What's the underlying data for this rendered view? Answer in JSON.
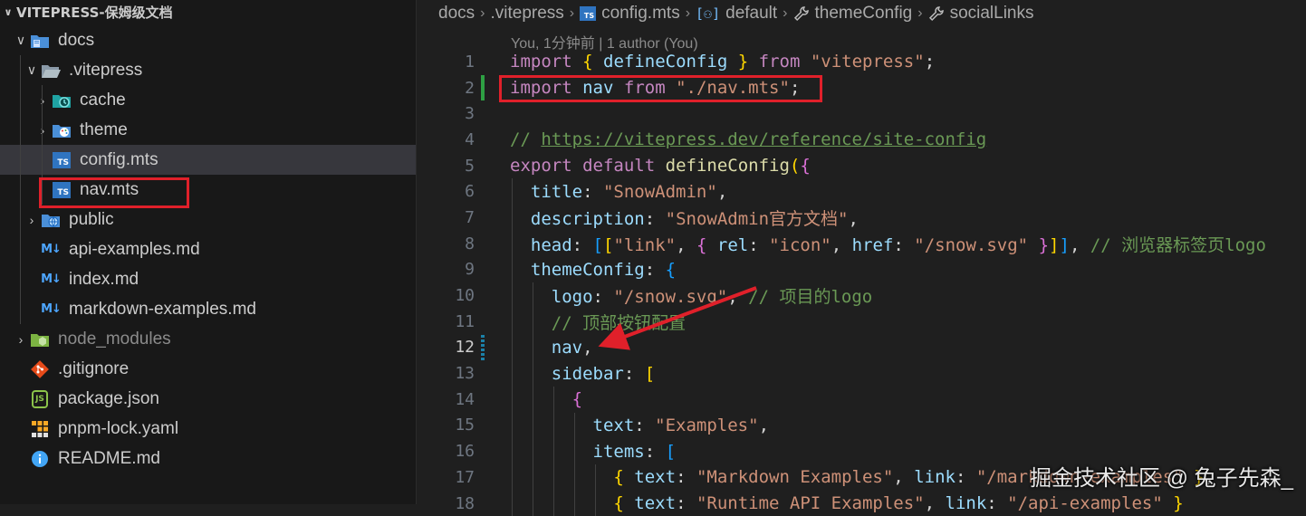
{
  "explorer": {
    "title": "VITEPRESS-保姆级文档",
    "items": [
      {
        "label": "docs"
      },
      {
        "label": ".vitepress"
      },
      {
        "label": "cache"
      },
      {
        "label": "theme"
      },
      {
        "label": "config.mts"
      },
      {
        "label": "nav.mts"
      },
      {
        "label": "public"
      },
      {
        "label": "api-examples.md"
      },
      {
        "label": "index.md"
      },
      {
        "label": "markdown-examples.md"
      },
      {
        "label": "node_modules"
      },
      {
        "label": ".gitignore"
      },
      {
        "label": "package.json"
      },
      {
        "label": "pnpm-lock.yaml"
      },
      {
        "label": "README.md"
      }
    ]
  },
  "breadcrumbs": [
    "docs",
    ".vitepress",
    "config.mts",
    "default",
    "themeConfig",
    "socialLinks"
  ],
  "blame": "You, 1分钟前 | 1 author (You)",
  "code": {
    "line_numbers": [
      "1",
      "2",
      "3",
      "4",
      "5",
      "6",
      "7",
      "8",
      "9",
      "10",
      "11",
      "12",
      "13",
      "14",
      "15",
      "16",
      "17",
      "18"
    ],
    "t": {
      "import": "import",
      "from": "from",
      "export": "export",
      "default": "default",
      "defineConfig": "defineConfig",
      "nav": "nav",
      "vitepress_str": "\"vitepress\"",
      "navpath_str": "\"./nav.mts\"",
      "comment_prefix": "// ",
      "url": "https://vitepress.dev/reference/site-config",
      "title": "title",
      "snowadmin_str": "\"SnowAdmin\"",
      "description": "description",
      "desc_str": "\"SnowAdmin官方文档\"",
      "head": "head",
      "link_str": "\"link\"",
      "rel": "rel",
      "icon_str": "\"icon\"",
      "href": "href",
      "snowsvg_str": "\"/snow.svg\"",
      "comment_tab_logo": "// 浏览器标签页logo",
      "themeConfig": "themeConfig",
      "logo": "logo",
      "comment_project_logo": "// 项目的logo",
      "comment_nav_config": "// 顶部按钮配置",
      "sidebar": "sidebar",
      "text": "text",
      "examples_str": "\"Examples\"",
      "items": "items",
      "md_examples_str": "\"Markdown Examples\"",
      "link": "link",
      "md_link_str": "\"/markdown-examples\"",
      "rt_examples_str": "\"Runtime API Examples\"",
      "api_link_str": "\"/api-examples\""
    }
  },
  "watermark": "掘金技术社区 @ 兔子先森_",
  "colors": {
    "highlight_box": "#e0202a",
    "arrow": "#e0202a",
    "keyword": "#c586c0",
    "string": "#ce9178",
    "property": "#9cdcfe",
    "comment": "#6a9955",
    "function": "#dcdcaa",
    "storage": "#569cd6"
  }
}
